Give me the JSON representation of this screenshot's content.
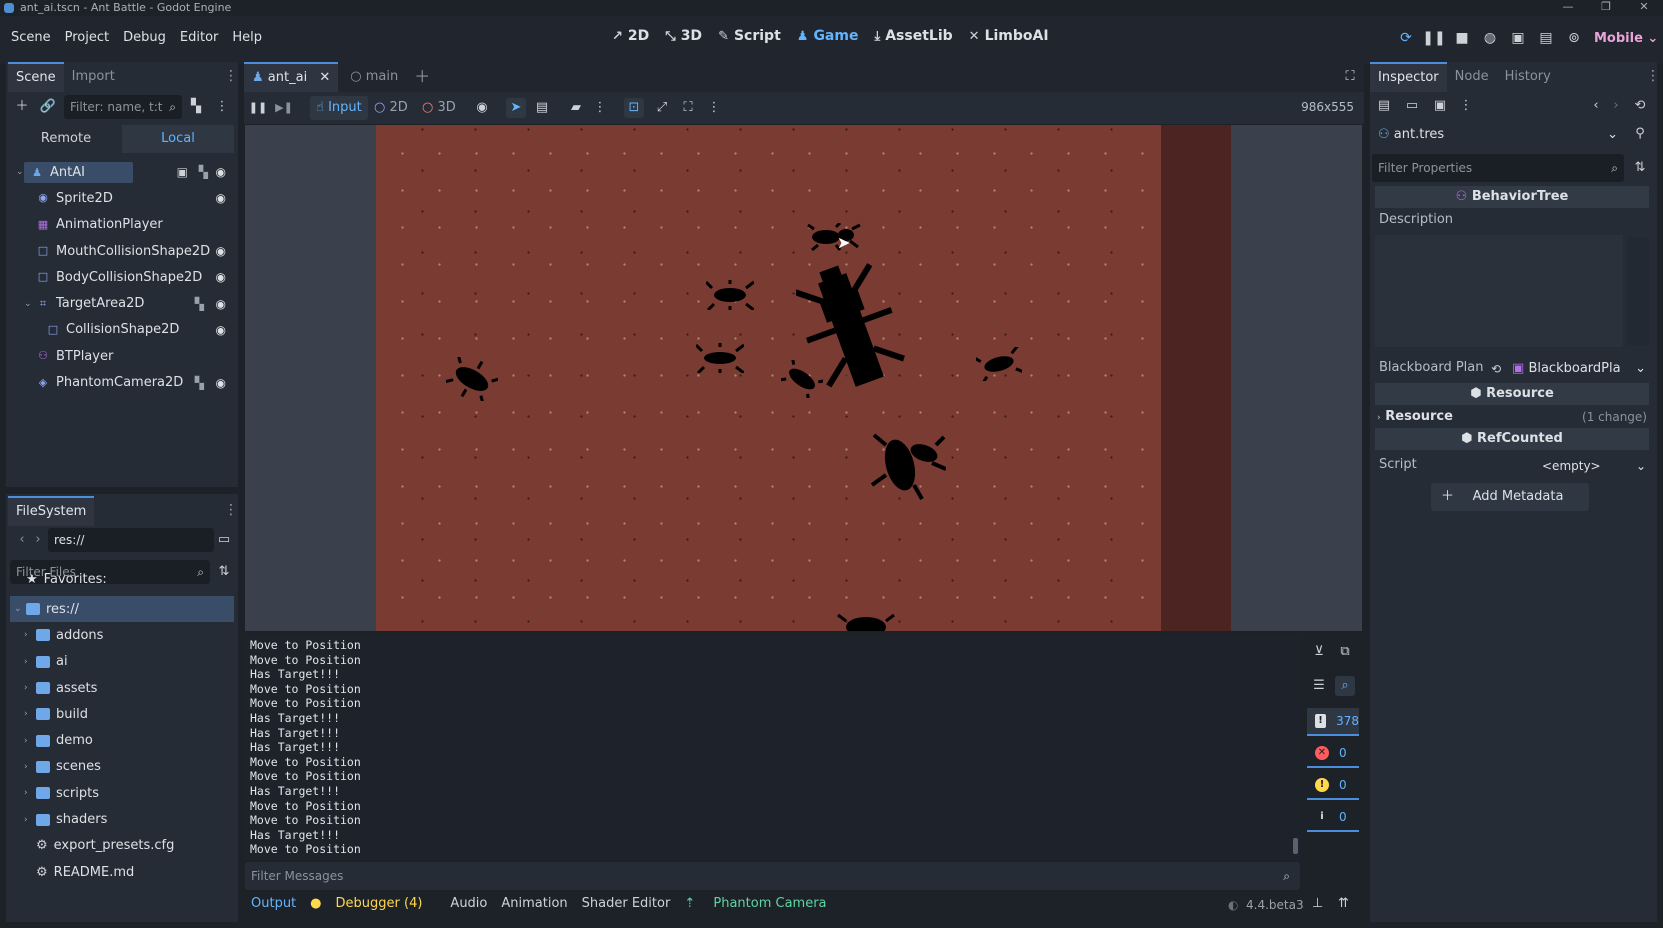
{
  "window": {
    "title": "ant_ai.tscn - Ant Battle - Godot Engine"
  },
  "menu": [
    "Scene",
    "Project",
    "Debug",
    "Editor",
    "Help"
  ],
  "workspaces": [
    {
      "label": "2D",
      "icon": "↗"
    },
    {
      "label": "3D",
      "icon": "⤡"
    },
    {
      "label": "Script",
      "icon": "✎"
    },
    {
      "label": "Game",
      "icon": "♟"
    },
    {
      "label": "AssetLib",
      "icon": "⤓"
    },
    {
      "label": "LimboAI",
      "icon": "✕"
    }
  ],
  "renderer": "Mobile",
  "scene_dock": {
    "tabs": [
      "Scene",
      "Import"
    ],
    "filter_placeholder": "Filter: name, t:t",
    "remote_label": "Remote",
    "local_label": "Local",
    "nodes": [
      {
        "name": "AntAI",
        "color": "#6fa8e8",
        "glyph": "♟"
      },
      {
        "name": "Sprite2D",
        "color": "#8da5f3",
        "glyph": "◉"
      },
      {
        "name": "AnimationPlayer",
        "color": "#b56ee8",
        "glyph": "▦"
      },
      {
        "name": "MouthCollisionShape2D",
        "color": "#8da5f3",
        "glyph": "□"
      },
      {
        "name": "BodyCollisionShape2D",
        "color": "#8da5f3",
        "glyph": "□"
      },
      {
        "name": "TargetArea2D",
        "color": "#8da5f3",
        "glyph": "⌗"
      },
      {
        "name": "CollisionShape2D",
        "color": "#8da5f3",
        "glyph": "□"
      },
      {
        "name": "BTPlayer",
        "color": "#b56ee8",
        "glyph": "⚇"
      },
      {
        "name": "PhantomCamera2D",
        "color": "#8da5f3",
        "glyph": "◈"
      }
    ]
  },
  "filesystem": {
    "tab": "FileSystem",
    "path": "res://",
    "filter_placeholder": "Filter Files",
    "favorites": "Favorites:",
    "root": "res://",
    "folders": [
      "addons",
      "ai",
      "assets",
      "build",
      "demo",
      "scenes",
      "scripts",
      "shaders"
    ],
    "files": [
      "export_presets.cfg",
      "README.md"
    ]
  },
  "editor_tabs": [
    {
      "label": "ant_ai"
    },
    {
      "label": "main"
    }
  ],
  "game_toolbar": {
    "input_label": "Input",
    "label_2d": "2D",
    "label_3d": "3D",
    "resolution": "986x555"
  },
  "console": {
    "lines": [
      "Move to Position",
      "Move to Position",
      "Has Target!!!",
      "Move to Position",
      "Move to Position",
      "Has Target!!!",
      "Has Target!!!",
      "Has Target!!!",
      "Move to Position",
      "Move to Position",
      "Has Target!!!",
      "Move to Position",
      "Move to Position",
      "Has Target!!!",
      "Move to Position"
    ],
    "filter_placeholder": "Filter Messages",
    "message_count": "378",
    "error_count": "0",
    "warning_count": "0",
    "info_count": "0"
  },
  "bottom_tabs": {
    "output": "Output",
    "debugger": "Debugger (4)",
    "audio": "Audio",
    "animation": "Animation",
    "shader_editor": "Shader Editor",
    "phantom_camera": "Phantom Camera",
    "version": "4.4.beta3"
  },
  "inspector": {
    "tabs": [
      "Inspector",
      "Node",
      "History"
    ],
    "resource_name": "ant.tres",
    "filter_placeholder": "Filter Properties",
    "class_header": "BehaviorTree",
    "description_label": "Description",
    "blackboard_label": "Blackboard Plan",
    "blackboard_value": "BlackboardPla",
    "resource_header": "Resource",
    "resource_group": "Resource",
    "resource_changes": "(1 change)",
    "refcounted_header": "RefCounted",
    "script_label": "Script",
    "script_value": "<empty>",
    "add_metadata": "Add Metadata"
  },
  "colors": {
    "accent": "#63b4ff",
    "ground": "#7a3b33",
    "error": "#ff5d5d",
    "warning": "#ffd84d"
  }
}
